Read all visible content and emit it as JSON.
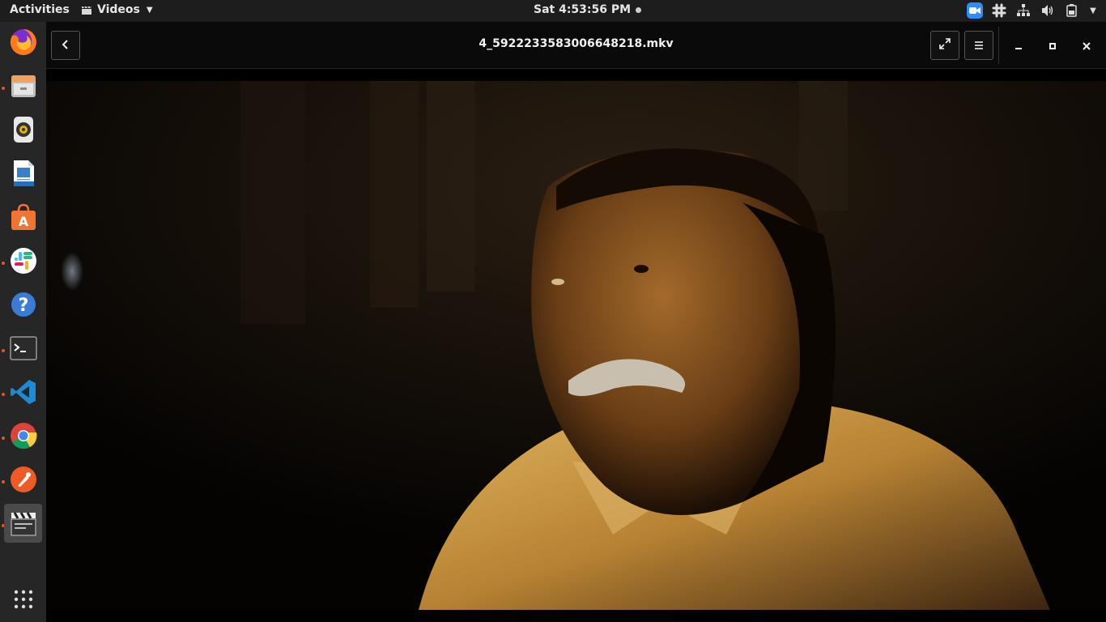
{
  "topbar": {
    "activities": "Activities",
    "app_menu": "Videos",
    "clock": "Sat  4:53:56 PM"
  },
  "dock": {
    "items": [
      {
        "name": "firefox",
        "running": false
      },
      {
        "name": "files",
        "running": true
      },
      {
        "name": "rhythmbox",
        "running": false
      },
      {
        "name": "libreoffice-writer",
        "running": false
      },
      {
        "name": "ubuntu-software",
        "running": false
      },
      {
        "name": "slack",
        "running": true
      },
      {
        "name": "help",
        "running": false
      },
      {
        "name": "terminal",
        "running": true
      },
      {
        "name": "vscode",
        "running": true
      },
      {
        "name": "chrome",
        "running": true
      },
      {
        "name": "postman",
        "running": true
      },
      {
        "name": "videos",
        "running": true,
        "active": true
      }
    ],
    "show_apps_icon": "grid-icon"
  },
  "player": {
    "title": "4_5922233583006648218.mkv",
    "back_icon": "chevron-left-icon",
    "fullscreen_icon": "fullscreen-icon",
    "menu_icon": "hamburger-menu-icon"
  },
  "colors": {
    "topbar_bg": "#1d1d1d",
    "dock_bg": "#262626",
    "running_dot": "#e95420",
    "zoom_blue": "#2d8cff"
  }
}
